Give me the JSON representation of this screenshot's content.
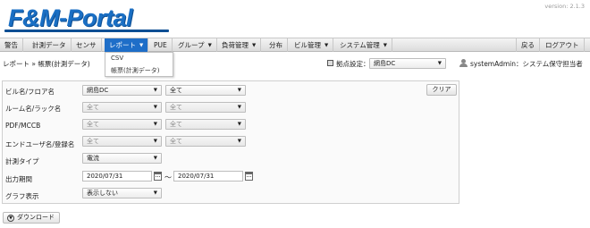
{
  "header": {
    "logo_text": "F&M-Portal",
    "version": "version: 2.1.3"
  },
  "menu": {
    "items": [
      {
        "label": "警告"
      },
      {
        "label": "計測データ"
      },
      {
        "label": "センサ"
      },
      {
        "label": "レポート"
      },
      {
        "label": "PUE"
      },
      {
        "label": "グループ"
      },
      {
        "label": "負荷管理"
      },
      {
        "label": "分布"
      },
      {
        "label": "ビル管理"
      },
      {
        "label": "システム管理"
      },
      {
        "label": "戻る"
      },
      {
        "label": "ログアウト"
      }
    ],
    "active": "レポート",
    "caret": "▼"
  },
  "report_dropdown": {
    "items": [
      "CSV",
      "帳票(計測データ)"
    ]
  },
  "breadcrumb": "レポート » 帳票(計測データ)",
  "site_setting": {
    "label": "拠点設定：",
    "value": "網島DC"
  },
  "user": {
    "label": "systemAdmin：システム保守担当者"
  },
  "form": {
    "rows": [
      {
        "label": "ビル名/フロア名",
        "select1": "網島DC",
        "select2": "全て"
      },
      {
        "label": "ルーム名/ラック名",
        "select1": "全て",
        "select2": "全て"
      },
      {
        "label": "PDF/MCCB",
        "select1": "全て",
        "select2": "全て"
      },
      {
        "label": "エンドユーザ名/登録名",
        "select1": "全て",
        "select2": "全て"
      },
      {
        "label": "計測タイプ",
        "select1": "電流"
      },
      {
        "label": "出力期間",
        "date_from": "2020/07/31",
        "date_to": "2020/07/31",
        "separator": "～"
      },
      {
        "label": "グラフ表示",
        "select1": "表示しない"
      }
    ],
    "clear_label": "クリア",
    "download_label": "ダウンロード"
  },
  "colors": {
    "accent": "#1e6ec8",
    "logo": "#1a6fc4"
  }
}
